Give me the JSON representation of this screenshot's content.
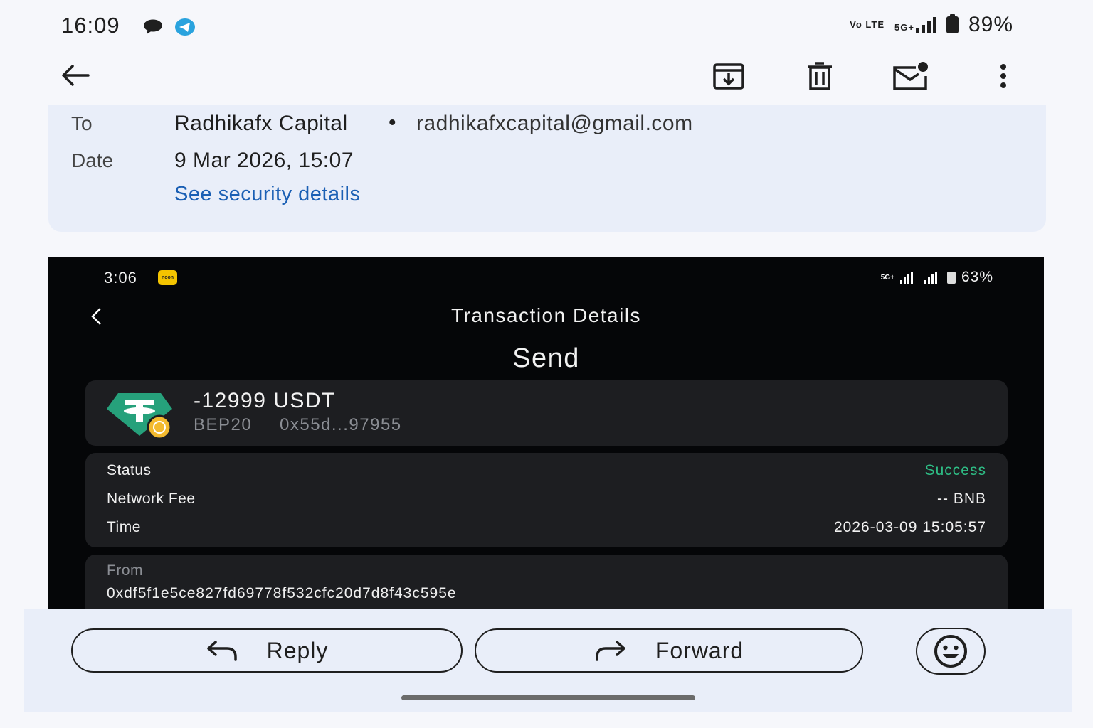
{
  "status_bar": {
    "time": "16:09",
    "network_lte": "Vo LTE",
    "network_5g": "5G+",
    "battery": "89%"
  },
  "toolbar": {
    "back_icon": "arrow-left-icon",
    "icons": [
      "archive-icon",
      "delete-icon",
      "mark-unread-icon",
      "more-vert-icon"
    ]
  },
  "header": {
    "to_label": "To",
    "to_name": "Radhikafx Capital",
    "bullet": "•",
    "to_email": "radhikafxcapital@gmail.com",
    "date_label": "Date",
    "date_value": "9 Mar 2026, 15:07",
    "security_link": "See security details"
  },
  "screenshot": {
    "status": {
      "time": "3:06",
      "badge": "noon",
      "network": "5G+",
      "battery": "63%"
    },
    "title": "Transaction Details",
    "type": "Send",
    "token": {
      "amount": "-12999 USDT",
      "network": "BEP20",
      "address": "0x55d...97955"
    },
    "details": [
      {
        "label": "Status",
        "value": "Success",
        "color": "#2ebd85"
      },
      {
        "label": "Network Fee",
        "value": "-- BNB"
      },
      {
        "label": "Time",
        "value": "2026-03-09 15:05:57"
      }
    ],
    "from_label": "From",
    "from_address": "0xdf5f1e5ce827fd69778f532cfc20d7d8f43c595e"
  },
  "actions": {
    "reply": "Reply",
    "forward": "Forward",
    "emoji_icon": "emoji-smile-icon"
  },
  "colors": {
    "accent_link": "#1a5fb4",
    "success": "#2ebd85",
    "tether": "#26a17b"
  }
}
